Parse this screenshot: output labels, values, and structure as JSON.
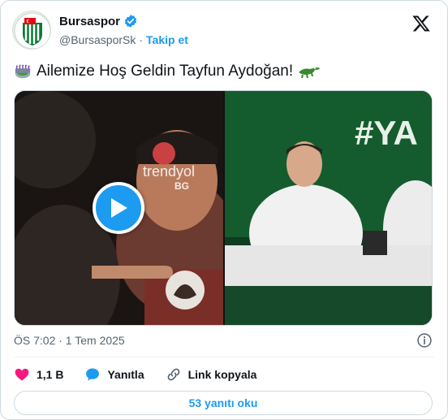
{
  "account": {
    "name": "Bursaspor",
    "handle": "@BursasporSk",
    "separator": "·",
    "follow_label": "Takip et"
  },
  "tweet": {
    "text": "Ailemize Hoş Geldin Tayfun Aydoğan!",
    "leading_emoji": "stadium-icon",
    "trailing_emoji": "crocodile-icon"
  },
  "media": {
    "left_watermark": "trendyol",
    "left_watermark_sub": "BG",
    "right_banner": "#YA"
  },
  "timestamp": "ÖS 7:02 · 1 Tem 2025",
  "actions": {
    "like_count": "1,1 B",
    "reply_label": "Yanıtla",
    "copy_link_label": "Link kopyala"
  },
  "read_replies_label": "53 yanıtı oku",
  "colors": {
    "accent": "#1d9bf0",
    "like": "#f91880",
    "text_secondary": "#536471",
    "brand_green": "#0b7a34"
  }
}
